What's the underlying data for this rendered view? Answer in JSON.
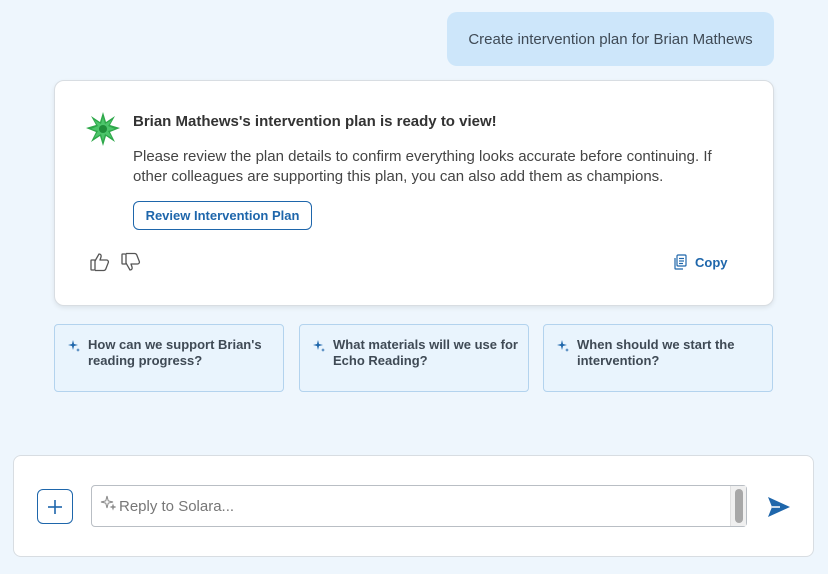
{
  "user_message": "Create intervention plan for Brian Mathews",
  "assistant": {
    "icon": "solara-star-icon",
    "title": "Brian Mathews's intervention plan is ready to view!",
    "body": "Please review the plan details to confirm everything looks accurate before continuing. If other colleagues are supporting this plan, you can also add them as champions.",
    "review_button_label": "Review Intervention Plan",
    "copy_label": "Copy"
  },
  "suggestions": [
    {
      "text": "How can we support Brian's reading progress?"
    },
    {
      "text": "What materials will we use for Echo Reading?"
    },
    {
      "text": "When should we start the intervention?"
    }
  ],
  "composer": {
    "placeholder": "Reply to Solara...",
    "value": ""
  },
  "colors": {
    "accent": "#1e66ab",
    "user_bubble": "#cde6fa",
    "background": "#eef6fd",
    "logo_green": "#2ea84a"
  }
}
